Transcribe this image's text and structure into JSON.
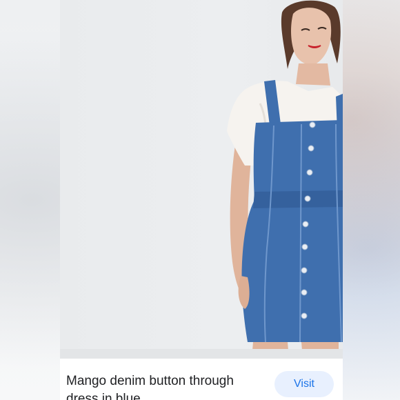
{
  "product": {
    "title": "Mango denim button through dress in blue",
    "image_alt": "Model wearing a blue denim button-through pinafore dress over a white t-shirt"
  },
  "actions": {
    "visit_label": "Visit"
  },
  "colors": {
    "button_bg": "#e8f0fe",
    "button_text": "#1a73e8",
    "denim": "#3f6fae",
    "photo_bg": "#eaecee"
  }
}
